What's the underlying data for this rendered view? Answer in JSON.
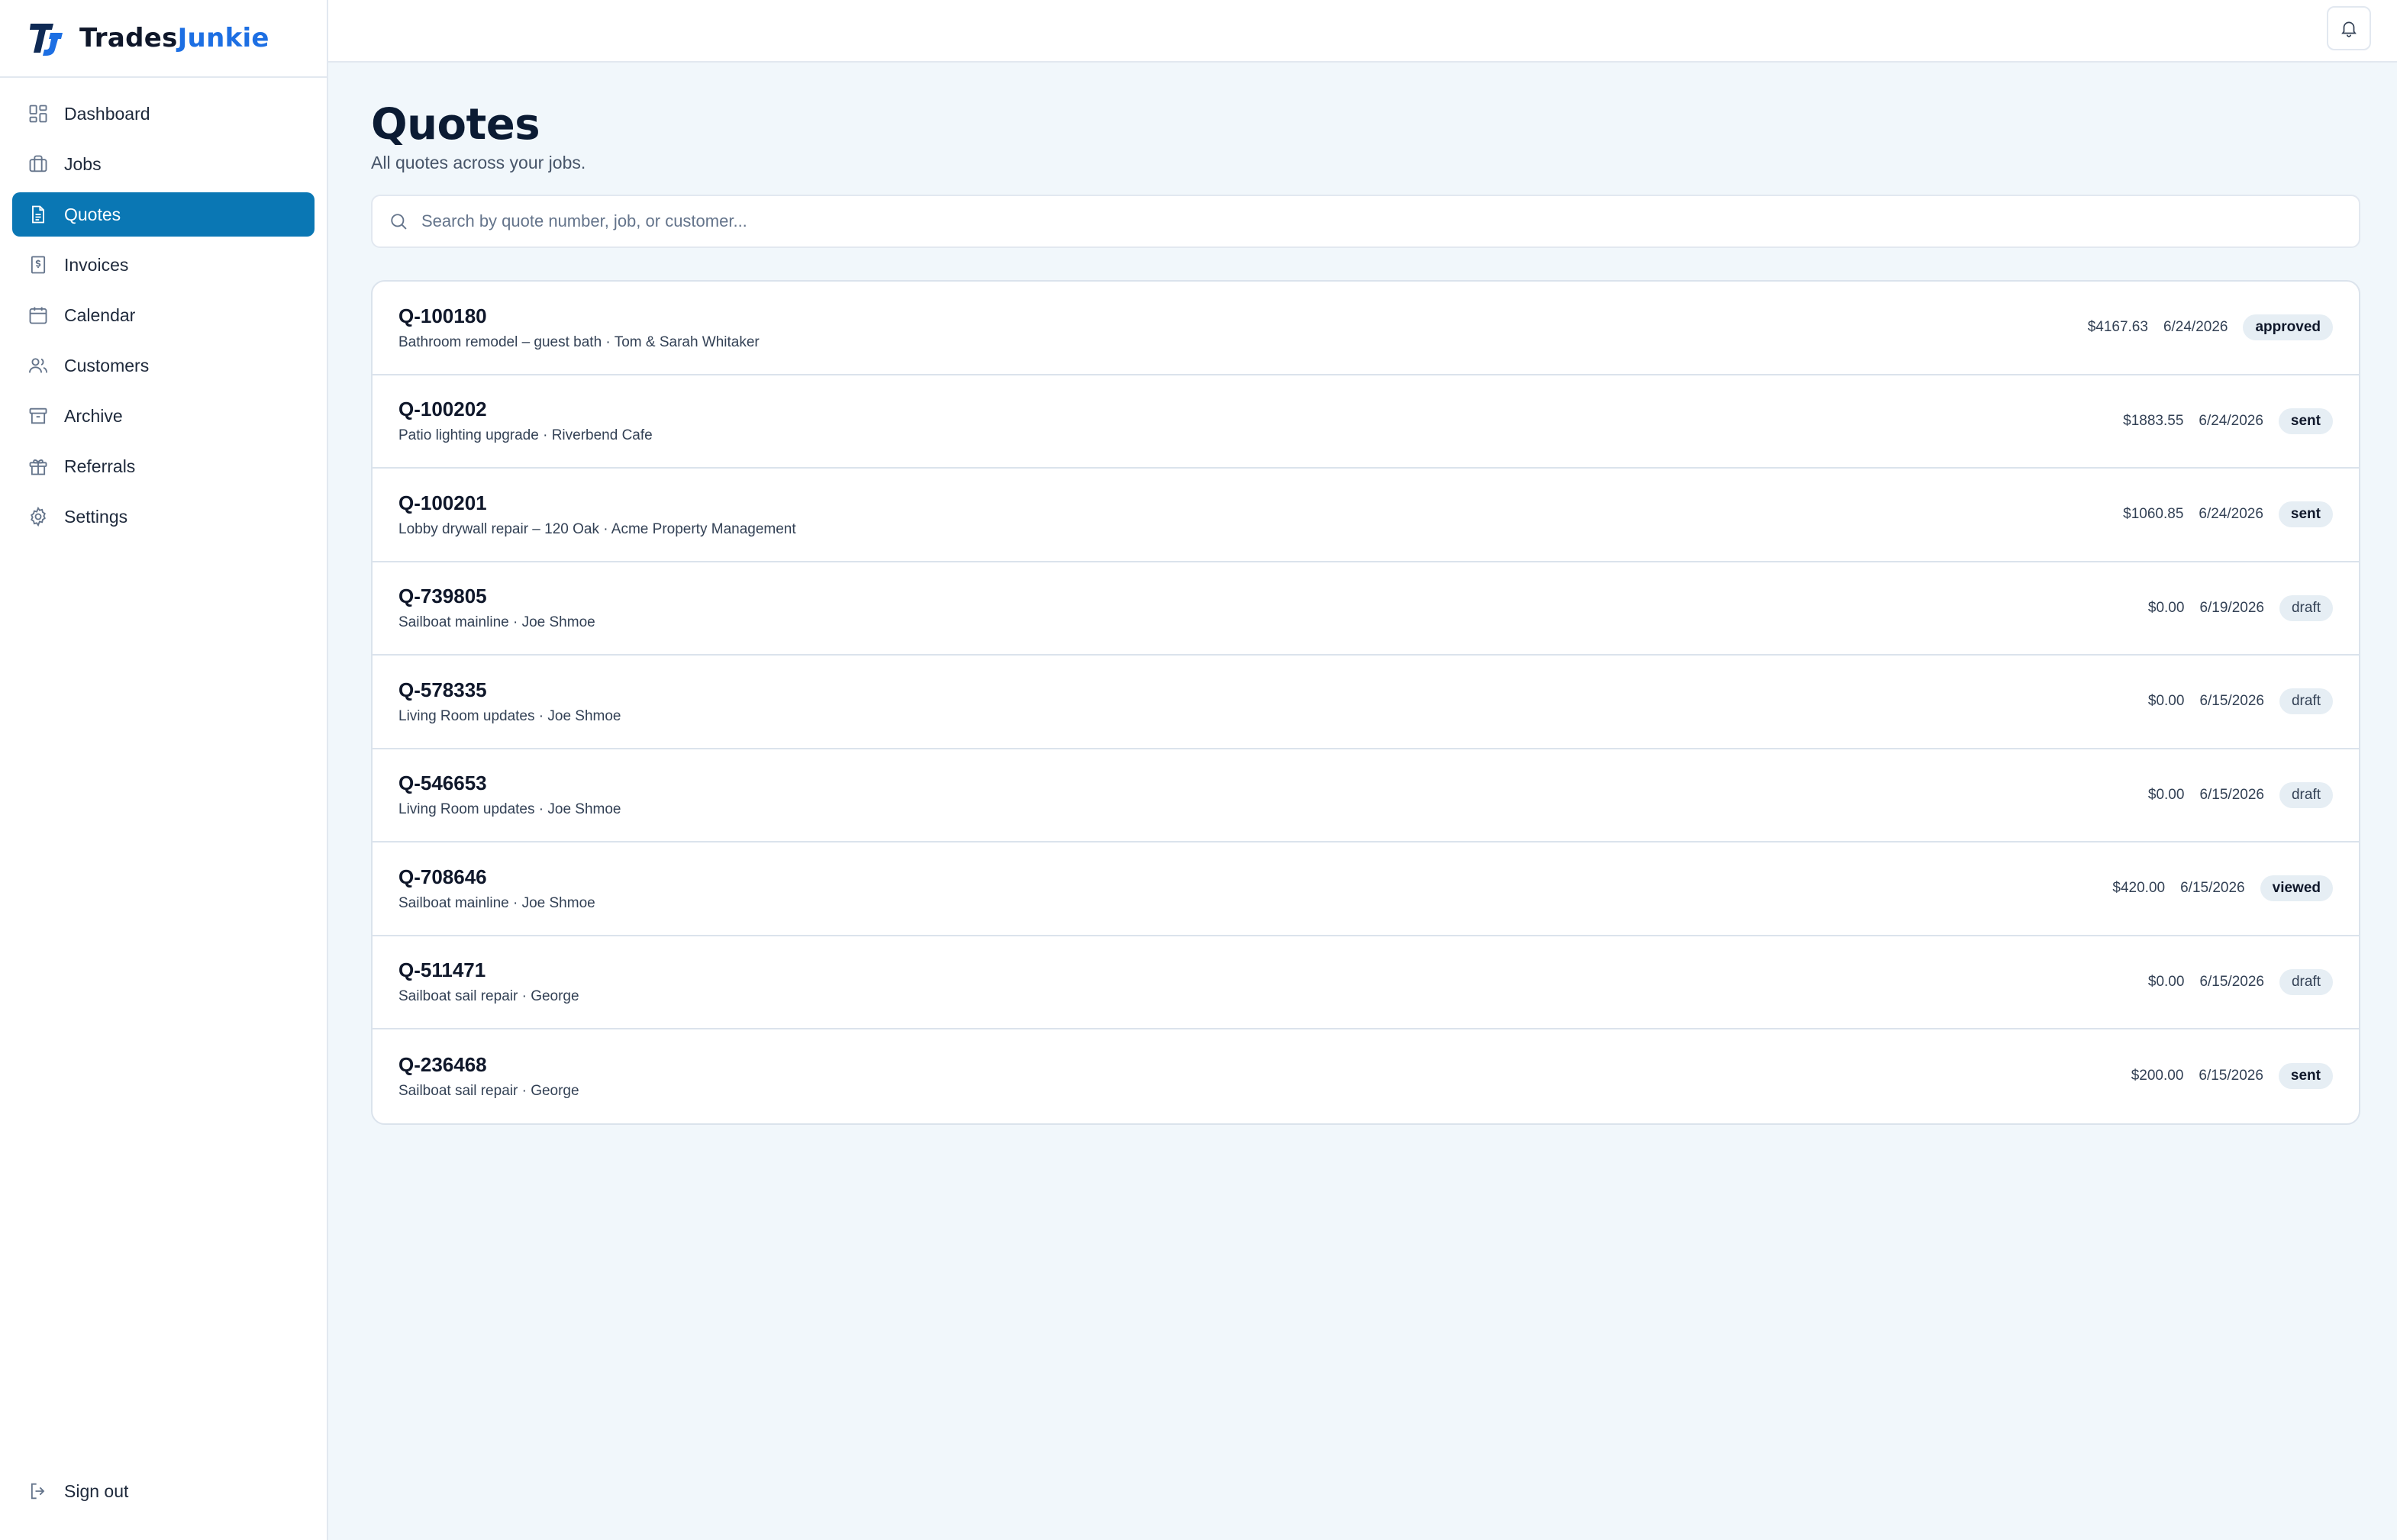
{
  "brand": {
    "name_part1": "Trades",
    "name_part2": "Junkie",
    "logo_text": "TJ"
  },
  "sidebar": {
    "items": [
      {
        "label": "Dashboard",
        "icon": "dashboard-icon",
        "active": false
      },
      {
        "label": "Jobs",
        "icon": "briefcase-icon",
        "active": false
      },
      {
        "label": "Quotes",
        "icon": "document-icon",
        "active": true
      },
      {
        "label": "Invoices",
        "icon": "invoice-icon",
        "active": false
      },
      {
        "label": "Calendar",
        "icon": "calendar-icon",
        "active": false
      },
      {
        "label": "Customers",
        "icon": "users-icon",
        "active": false
      },
      {
        "label": "Archive",
        "icon": "archive-icon",
        "active": false
      },
      {
        "label": "Referrals",
        "icon": "gift-icon",
        "active": false
      },
      {
        "label": "Settings",
        "icon": "gear-icon",
        "active": false
      }
    ],
    "signout_label": "Sign out"
  },
  "topbar": {
    "notifications_icon": "bell-icon"
  },
  "page": {
    "title": "Quotes",
    "subtitle": "All quotes across your jobs."
  },
  "search": {
    "placeholder": "Search by quote number, job, or customer...",
    "value": ""
  },
  "quotes": [
    {
      "number": "Q-100180",
      "description": "Bathroom remodel – guest bath · Tom & Sarah Whitaker",
      "amount": "$4167.63",
      "date": "6/24/2026",
      "status": "approved"
    },
    {
      "number": "Q-100202",
      "description": "Patio lighting upgrade · Riverbend Cafe",
      "amount": "$1883.55",
      "date": "6/24/2026",
      "status": "sent"
    },
    {
      "number": "Q-100201",
      "description": "Lobby drywall repair – 120 Oak · Acme Property Management",
      "amount": "$1060.85",
      "date": "6/24/2026",
      "status": "sent"
    },
    {
      "number": "Q-739805",
      "description": "Sailboat mainline · Joe Shmoe",
      "amount": "$0.00",
      "date": "6/19/2026",
      "status": "draft"
    },
    {
      "number": "Q-578335",
      "description": "Living Room updates · Joe Shmoe",
      "amount": "$0.00",
      "date": "6/15/2026",
      "status": "draft"
    },
    {
      "number": "Q-546653",
      "description": "Living Room updates · Joe Shmoe",
      "amount": "$0.00",
      "date": "6/15/2026",
      "status": "draft"
    },
    {
      "number": "Q-708646",
      "description": "Sailboat mainline · Joe Shmoe",
      "amount": "$420.00",
      "date": "6/15/2026",
      "status": "viewed"
    },
    {
      "number": "Q-511471",
      "description": "Sailboat sail repair · George",
      "amount": "$0.00",
      "date": "6/15/2026",
      "status": "draft"
    },
    {
      "number": "Q-236468",
      "description": "Sailboat sail repair · George",
      "amount": "$200.00",
      "date": "6/15/2026",
      "status": "sent"
    }
  ],
  "colors": {
    "accent": "#0a77b4",
    "brand_blue": "#1d6fe3",
    "background": "#f1f7fb",
    "badge_bg": "#e6eef4"
  }
}
